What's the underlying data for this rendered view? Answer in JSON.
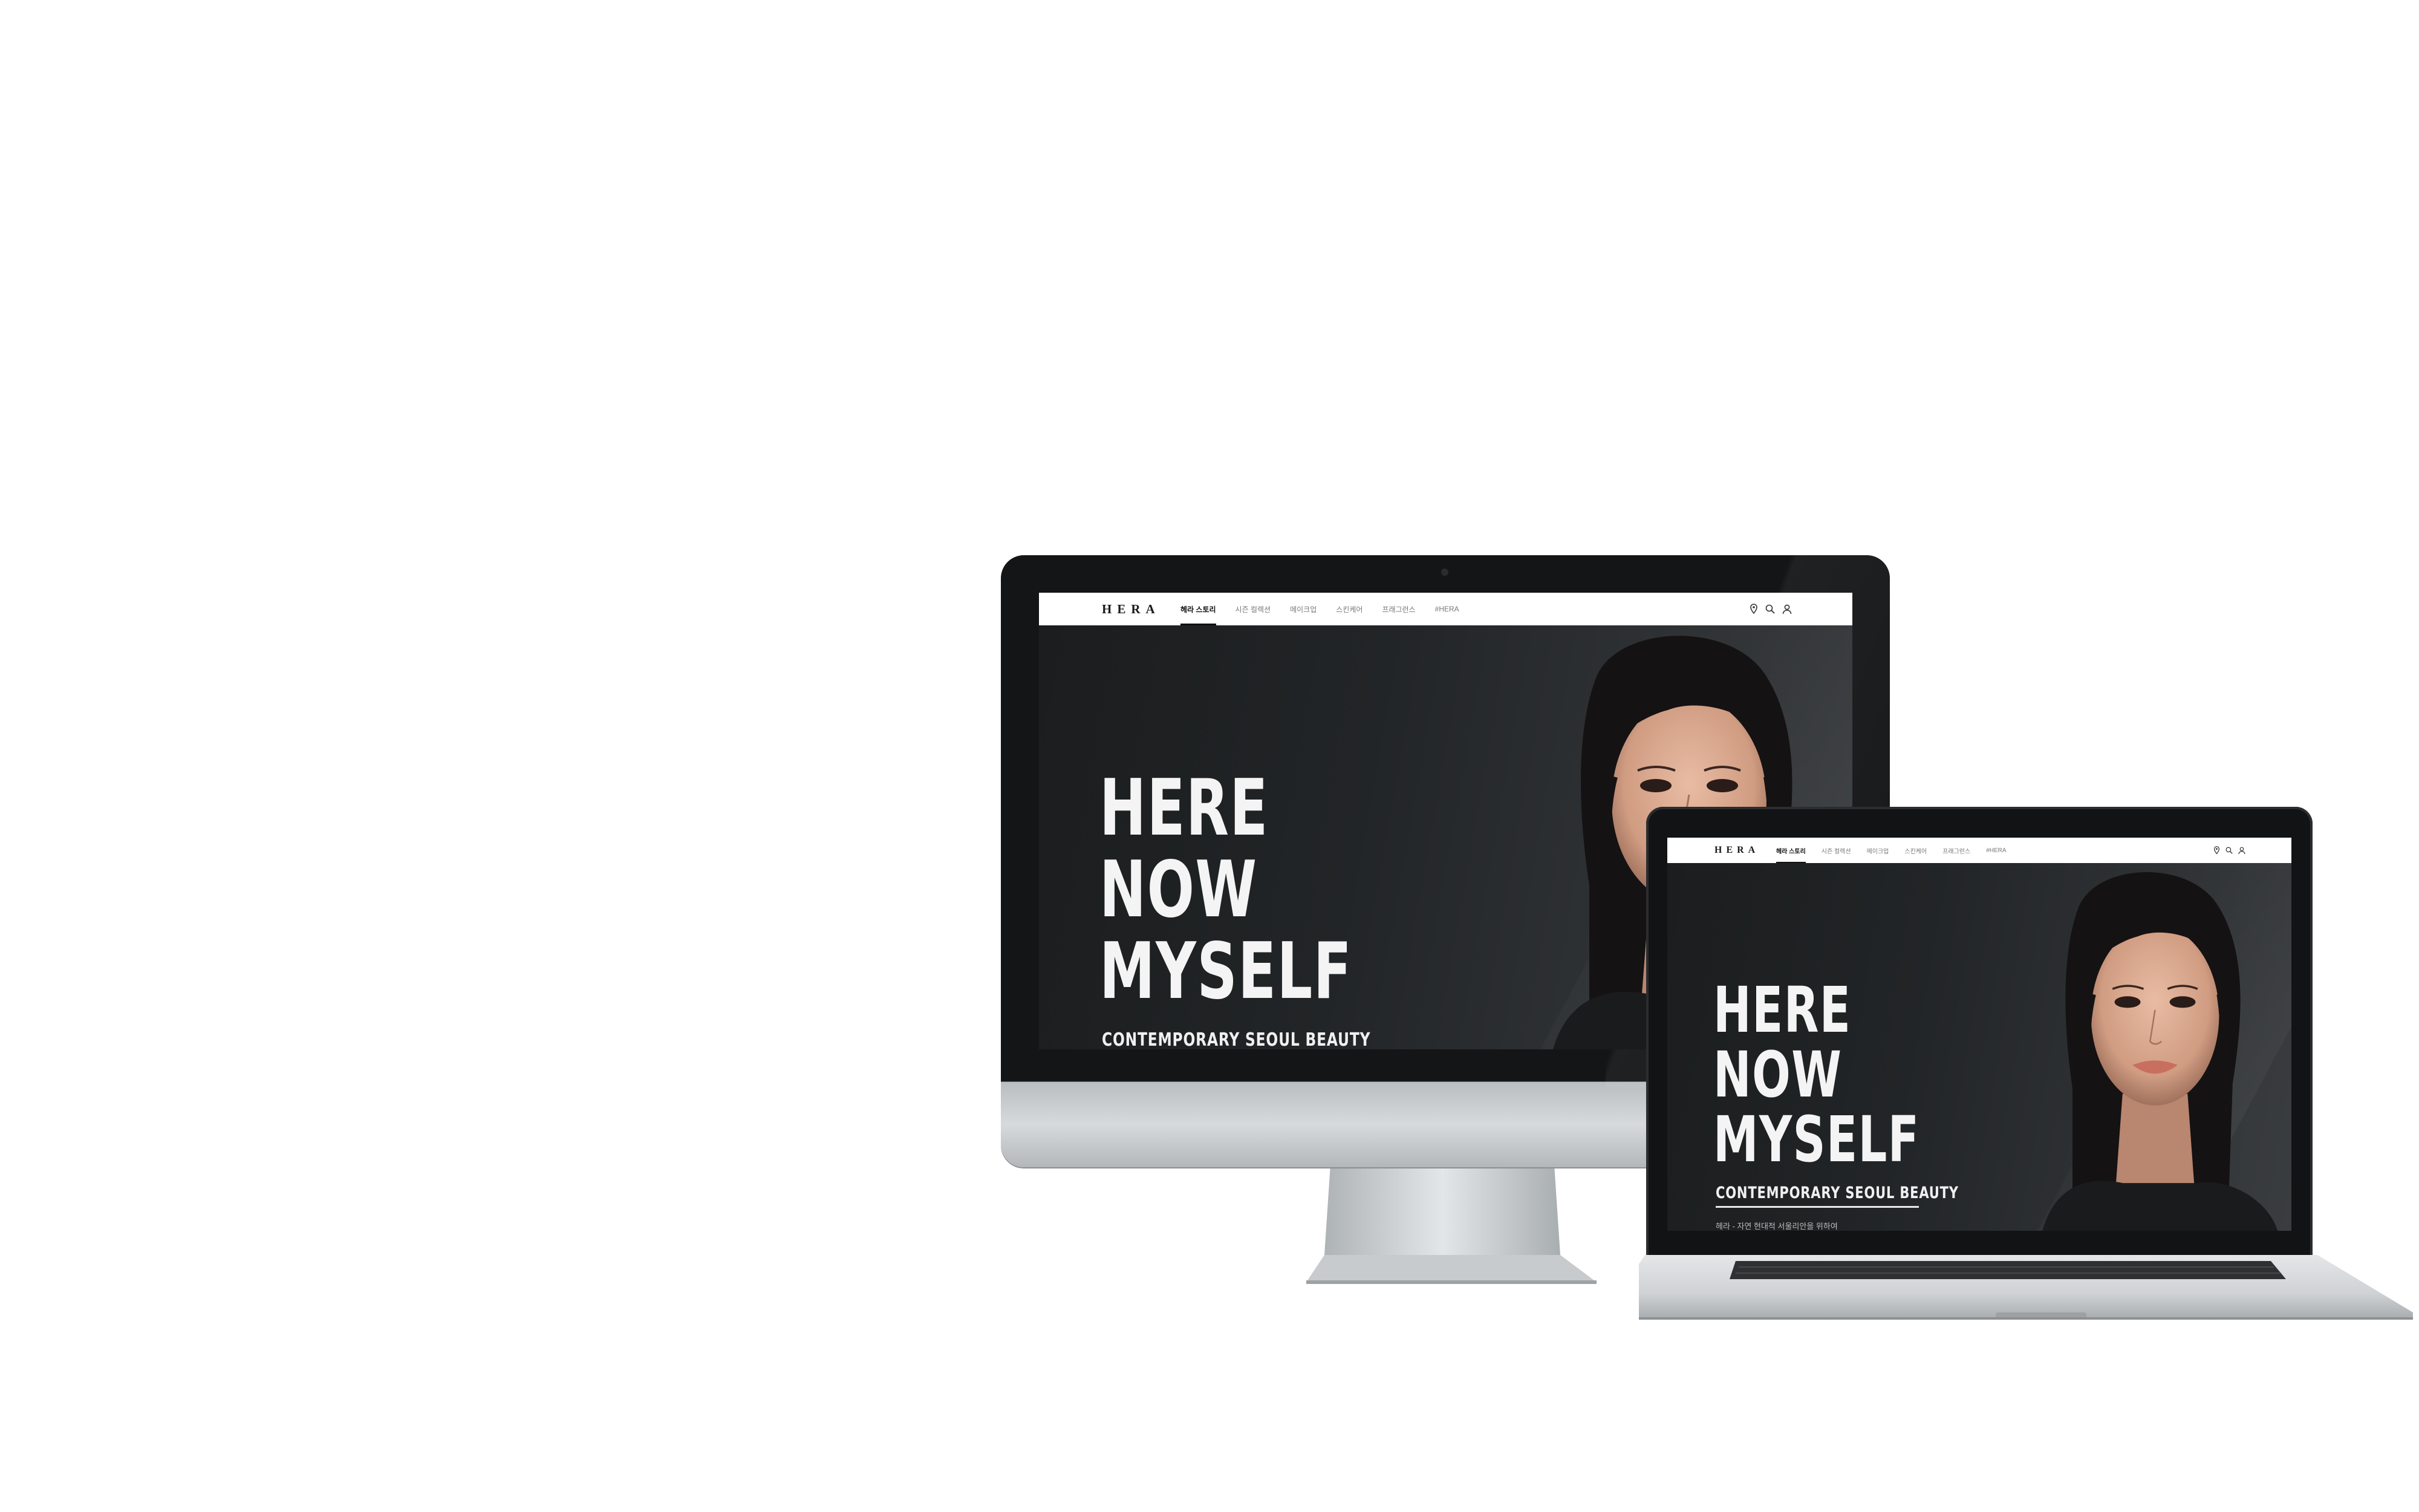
{
  "brand": {
    "logo": "HERA"
  },
  "nav": {
    "items": [
      {
        "label": "헤라 스토리",
        "active": true
      },
      {
        "label": "시즌 컬렉션",
        "active": false
      },
      {
        "label": "메이크업",
        "active": false
      },
      {
        "label": "스킨케어",
        "active": false
      },
      {
        "label": "프래그런스",
        "active": false
      },
      {
        "label": "#HERA",
        "active": false
      }
    ],
    "icons": [
      "location-pin-icon",
      "search-icon",
      "user-icon"
    ]
  },
  "hero": {
    "headline": [
      "HERE",
      "NOW",
      "MYSELF"
    ],
    "subtitle": "CONTEMPORARY SEOUL BEAUTY",
    "tagline": "헤라 - 자연 현대적 서울리안을 위하여"
  },
  "colors": {
    "hero_bg": "#222527",
    "nav_bg": "#ffffff",
    "device_bezel": "#161718",
    "aluminum": "#c9cdd0"
  }
}
